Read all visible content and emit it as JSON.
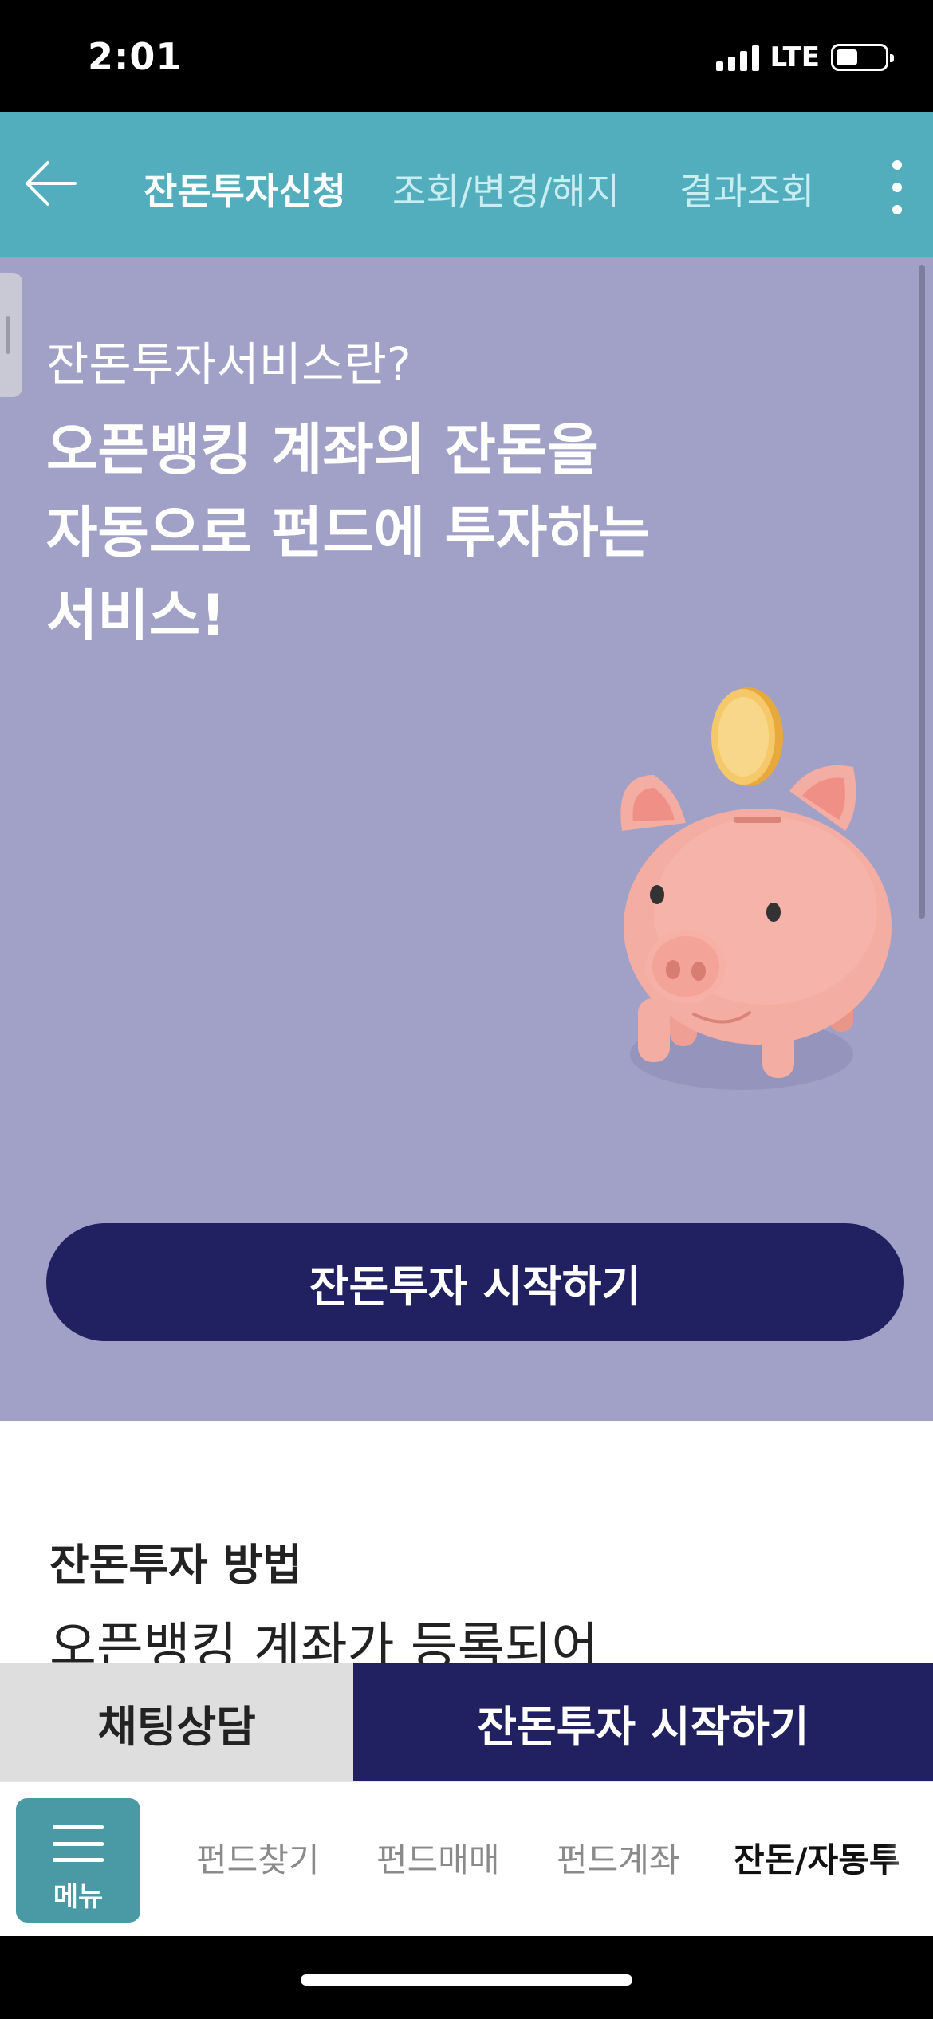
{
  "status_bar": {
    "time": "2:01",
    "network": "LTE"
  },
  "header": {
    "tabs": [
      {
        "label": "잔돈투자신청",
        "active": true
      },
      {
        "label": "조회/변경/해지",
        "active": false
      },
      {
        "label": "결과조회",
        "active": false
      }
    ]
  },
  "hero": {
    "subtitle": "잔돈투자서비스란?",
    "title_lines": [
      "오픈뱅킹 계좌의 잔돈을",
      "자동으로 펀드에 투자하는",
      "서비스!"
    ],
    "start_button": "잔돈투자 시작하기",
    "background_color": "#a1a1c8"
  },
  "content": {
    "section_title": "잔돈투자 방법",
    "section_body": "오픈뱅킹 계좌가 등록되어"
  },
  "bottom_actions": {
    "chat_button": "채팅상담",
    "start_button": "잔돈투자 시작하기"
  },
  "tabbar": {
    "menu_label": "메뉴",
    "items": [
      {
        "label": "펀드찾기",
        "active": false
      },
      {
        "label": "펀드매매",
        "active": false
      },
      {
        "label": "펀드계좌",
        "active": false
      },
      {
        "label": "잔돈/자동투",
        "active": true
      }
    ]
  },
  "colors": {
    "header": "#52aebd",
    "primary_navy": "#212061",
    "menu_button": "#4a9aa6"
  }
}
